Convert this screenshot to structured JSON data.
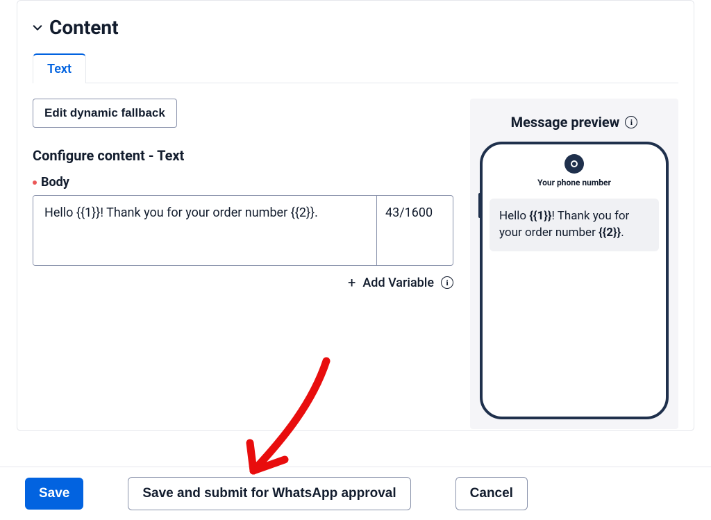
{
  "section": {
    "title": "Content"
  },
  "tabs": {
    "text": "Text"
  },
  "buttons": {
    "edit_dynamic_fallback": "Edit dynamic fallback",
    "add_variable": "Add Variable",
    "save": "Save",
    "save_submit": "Save and submit for WhatsApp approval",
    "cancel": "Cancel"
  },
  "configure": {
    "heading": "Configure content - Text",
    "body_label": "Body",
    "body_value": "Hello {{1}}! Thank you for your order number {{2}}.",
    "char_count": "43/1600"
  },
  "preview": {
    "title": "Message preview",
    "phone_label": "Your phone number",
    "bubble_prefix": "Hello ",
    "var1": "{{1}}",
    "bubble_mid1": "! Thank you for your order number ",
    "var2": "{{2}}",
    "bubble_suffix": "."
  }
}
